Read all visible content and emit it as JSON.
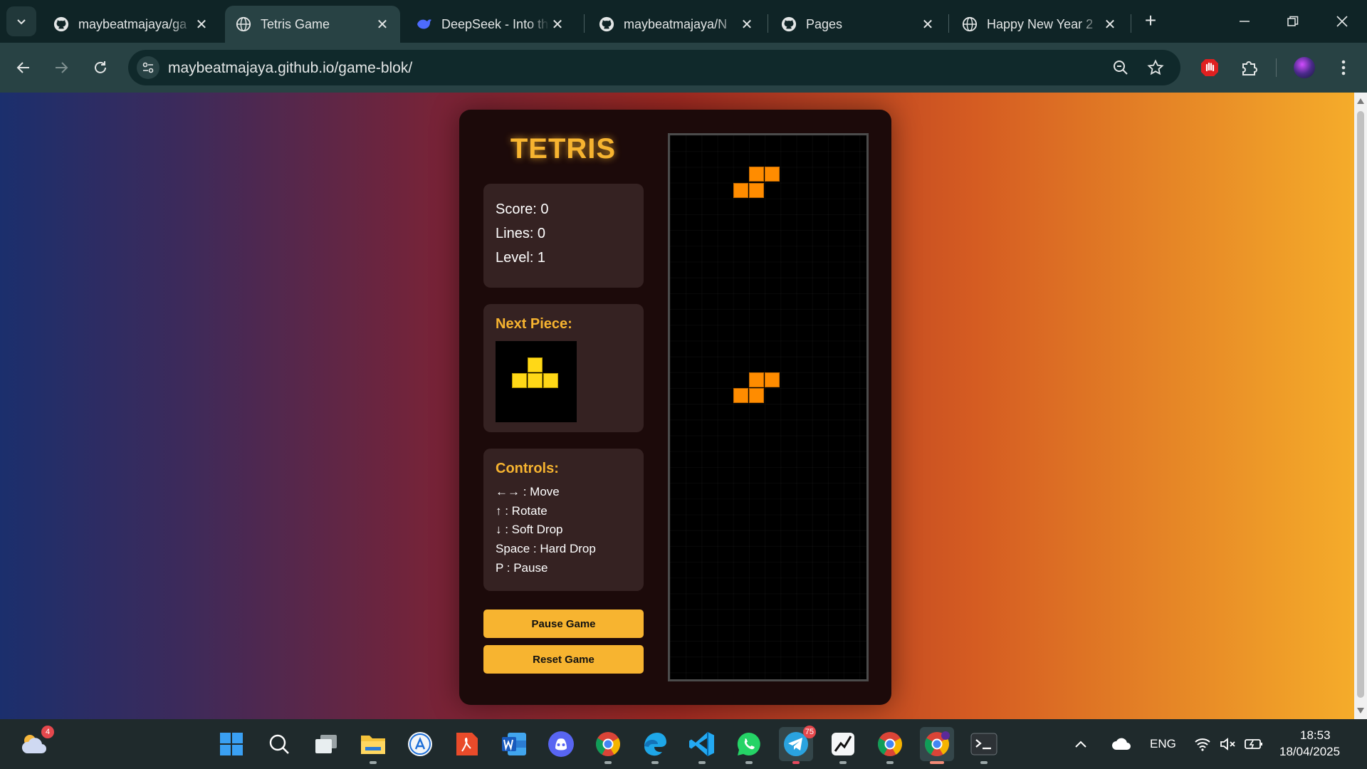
{
  "browser": {
    "tabs": [
      {
        "title": "maybeatmajaya/ga",
        "icon": "github-icon",
        "active": false
      },
      {
        "title": "Tetris Game",
        "icon": "globe-icon",
        "active": true
      },
      {
        "title": "DeepSeek - Into th",
        "icon": "deepseek-icon",
        "active": false
      },
      {
        "title": "maybeatmajaya/N",
        "icon": "github-icon",
        "active": false
      },
      {
        "title": "Pages",
        "icon": "github-icon",
        "active": false
      },
      {
        "title": "Happy New Year 2",
        "icon": "globe-icon",
        "active": false
      }
    ],
    "url": "maybeatmajaya.github.io/game-blok/",
    "accent": "#284244"
  },
  "game": {
    "title": "TETRIS",
    "score_label": "Score: 0",
    "lines_label": "Lines: 0",
    "level_label": "Level: 1",
    "next_piece_heading": "Next Piece:",
    "next_piece_shape": "T",
    "controls_heading": "Controls:",
    "controls": [
      "←→ : Move",
      "↑ : Rotate",
      "↓ : Soft Drop",
      "Space : Hard Drop",
      "P : Pause"
    ],
    "pause_button": "Pause Game",
    "reset_button": "Reset Game",
    "piece_color": "#ff8c00",
    "next_color": "#ffd817",
    "accent": "#f7b430"
  },
  "taskbar": {
    "weather_badge": "4",
    "telegram_badge": "75",
    "language": "ENG",
    "time": "18:53",
    "date": "18/04/2025"
  }
}
